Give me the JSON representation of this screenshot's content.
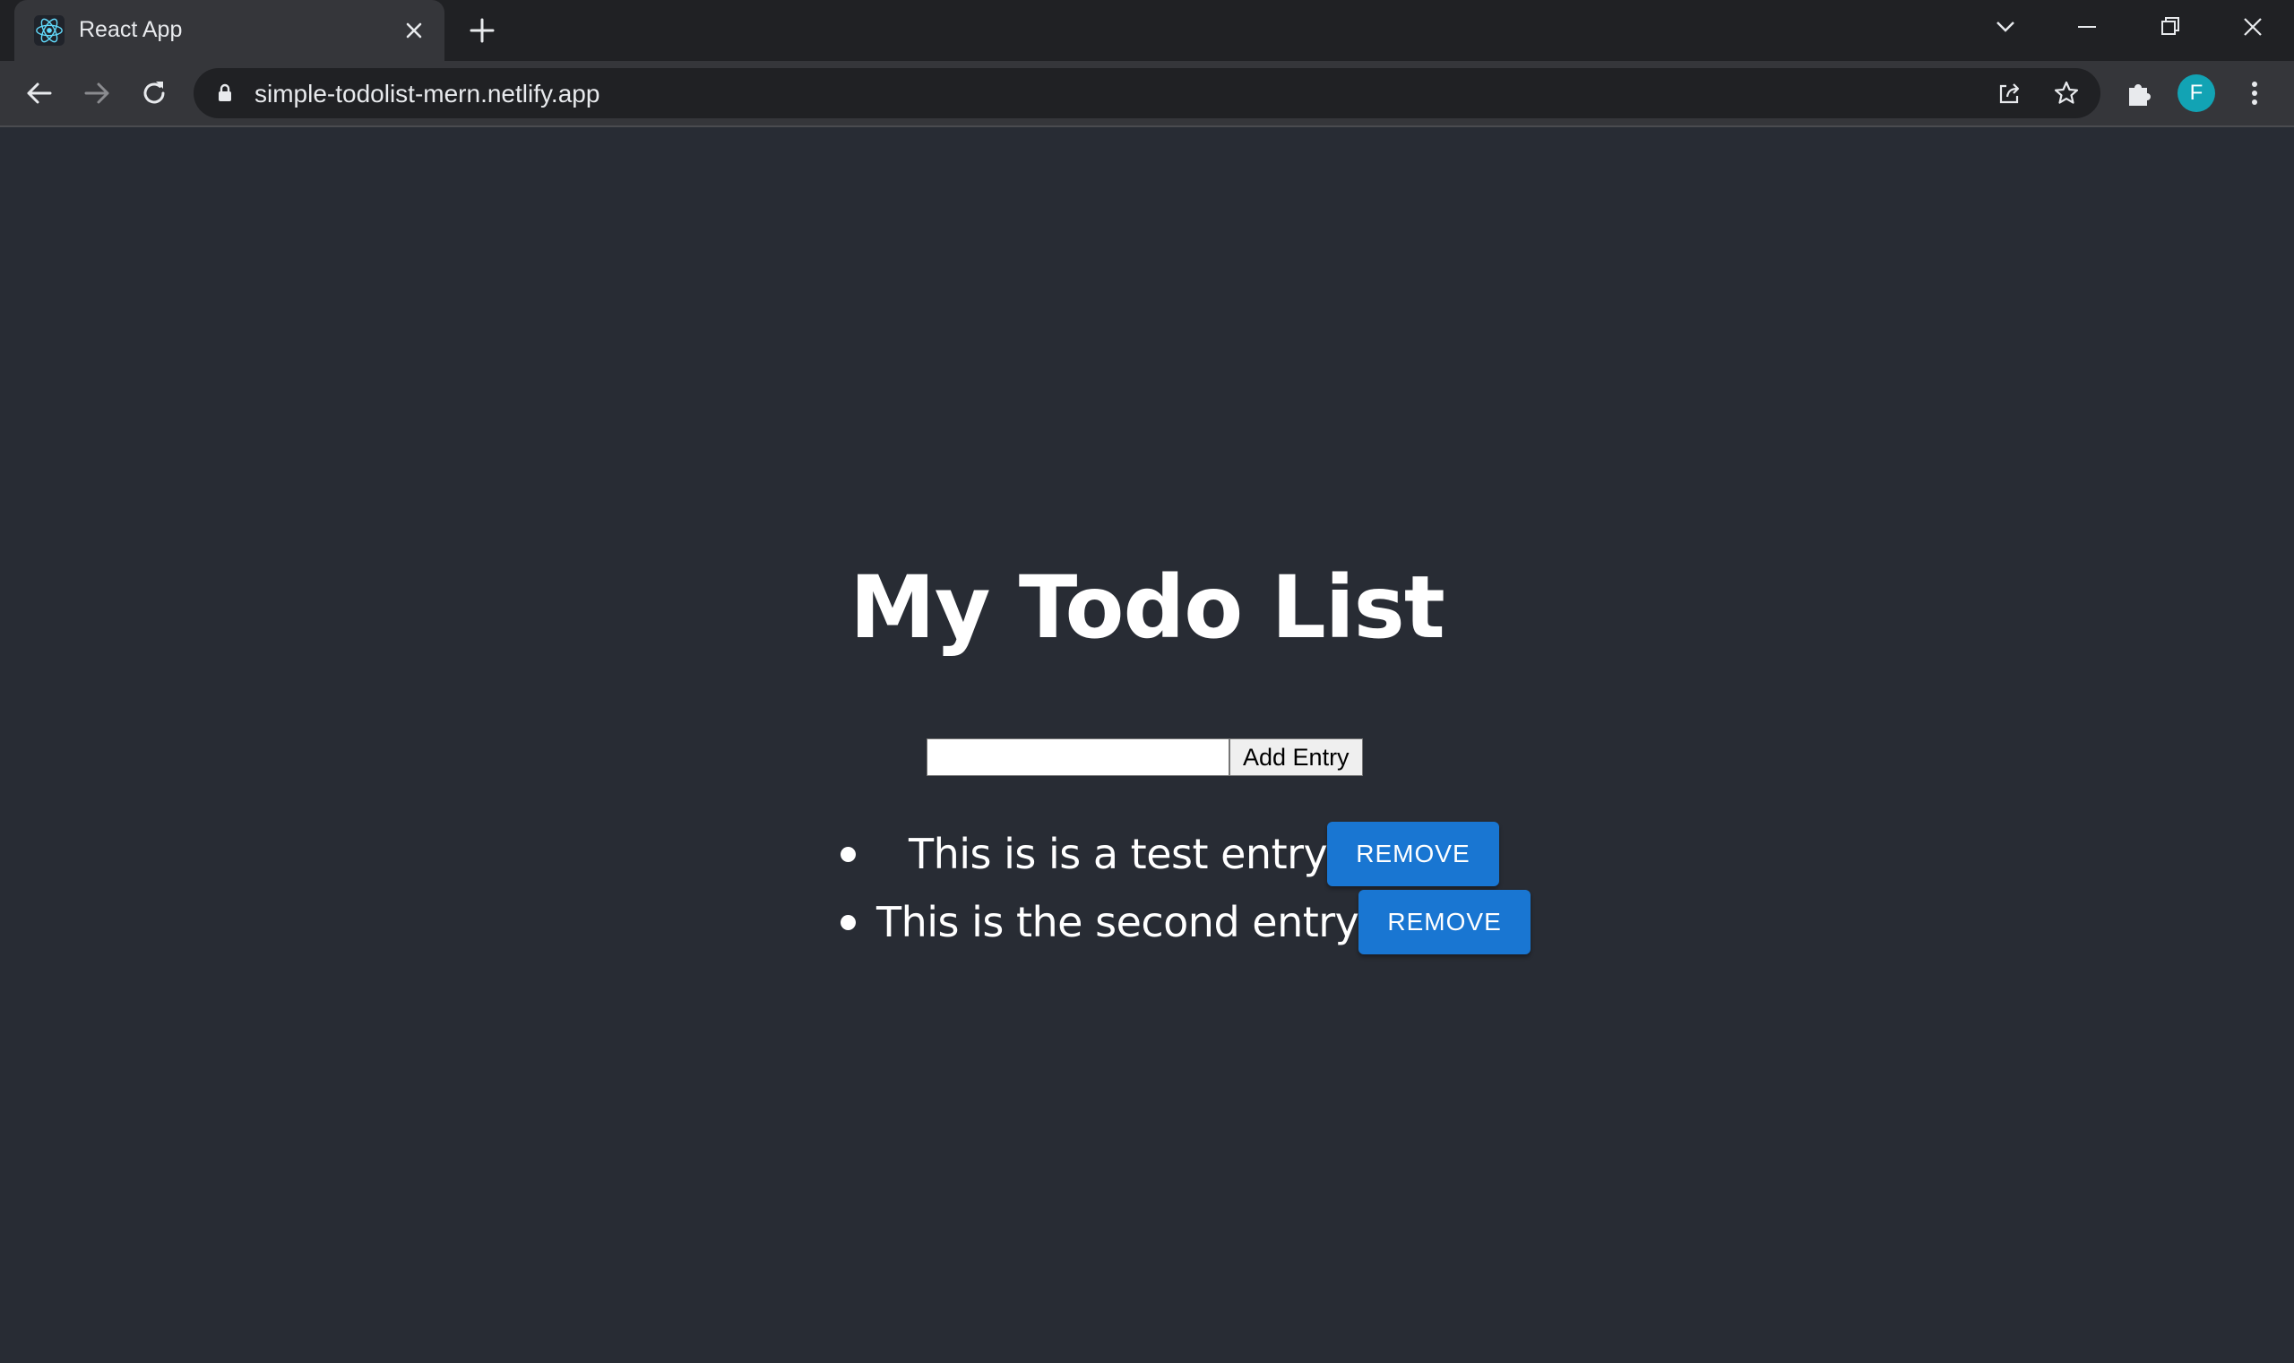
{
  "browser": {
    "tab_title": "React App",
    "url": "simple-todolist-mern.netlify.app",
    "profile_initial": "F",
    "icons": {
      "favicon": "react-logo-icon",
      "close_tab": "close-icon",
      "new_tab": "plus-icon",
      "tab_search": "chevron-down-icon",
      "minimize": "minimize-icon",
      "restore": "restore-icon",
      "close_window": "close-icon",
      "back": "back-arrow-icon",
      "forward": "forward-arrow-icon",
      "reload": "reload-icon",
      "lock": "lock-icon",
      "share": "share-icon",
      "bookmark": "star-icon",
      "extensions": "puzzle-icon",
      "menu": "kebab-menu-icon"
    },
    "colors": {
      "tabstrip": "#202124",
      "toolbar": "#35363a",
      "avatar": "#12a3b4"
    }
  },
  "app": {
    "title": "My Todo List",
    "input_value": "",
    "add_button_label": "Add Entry",
    "todos": [
      {
        "text": "This is is a test entry",
        "remove_label": "REMOVE"
      },
      {
        "text": "This is the second entry",
        "remove_label": "REMOVE"
      }
    ],
    "colors": {
      "background": "#282c34",
      "remove_button": "#1976d2"
    }
  }
}
